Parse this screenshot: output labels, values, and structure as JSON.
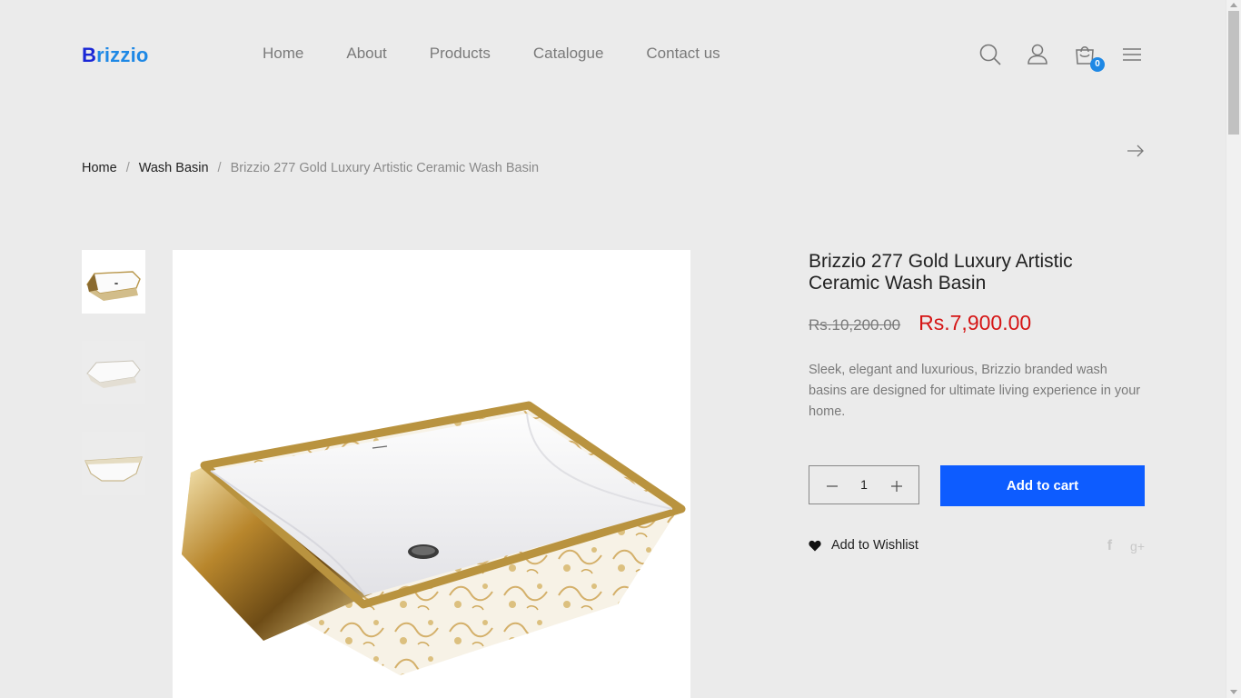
{
  "brand": {
    "logo_first": "B",
    "logo_rest": "rizzio"
  },
  "nav": {
    "items": [
      "Home",
      "About",
      "Products",
      "Catalogue",
      "Contact us"
    ]
  },
  "header": {
    "icons": [
      "search-icon",
      "user-icon",
      "cart-icon",
      "menu-icon"
    ],
    "cart_count": "0"
  },
  "breadcrumb": {
    "home": "Home",
    "category": "Wash Basin",
    "current": "Brizzio 277 Gold Luxury Artistic Ceramic Wash Basin",
    "separator": "/"
  },
  "product": {
    "title": "Brizzio 277 Gold Luxury Artistic Ceramic Wash Basin",
    "old_price": "Rs.10,200.00",
    "price": "Rs.7,900.00",
    "description": "Sleek, elegant and luxurious, Brizzio branded wash basins are designed for ultimate living experience in your home.",
    "quantity": "1",
    "add_to_cart": "Add to cart",
    "wishlist": "Add to Wishlist",
    "social": {
      "facebook": "f",
      "google_plus": "g+"
    }
  },
  "colors": {
    "background": "#ebebeb",
    "primary_button": "#0d5cff",
    "sale_price": "#d51515",
    "logo_dark": "#1a27d6",
    "logo_light": "#1e88e5",
    "badge": "#1e88e5"
  }
}
